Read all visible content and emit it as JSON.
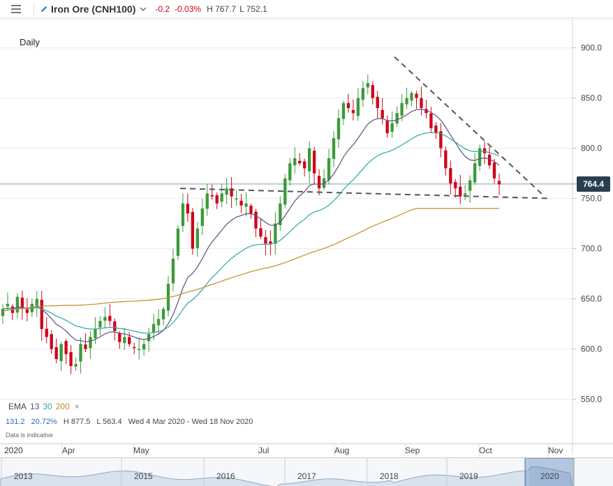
{
  "header": {
    "menu_icon": "hamburger-menu-icon",
    "edit_icon": "pencil-icon",
    "instrument_title": "Iron Ore (CNH100)",
    "chevron_icon": "chevron-down-icon",
    "change": "-0.2",
    "change_pct": "-0.03%",
    "high": "H 767.7",
    "low": "L 752.1"
  },
  "period_label": "Daily",
  "last_price": "764.4",
  "ema_legend": {
    "label": "EMA",
    "period_1": "13",
    "period_2": "30",
    "period_3": "200",
    "remove": "×"
  },
  "stats": {
    "change_abs": "131.2",
    "change_pct": "20.72%",
    "high": "H 877.5",
    "low": "L 563.4",
    "range": "Wed 4 Mar 2020 - Wed 18 Nov 2020"
  },
  "disclaimer": "Data is indicative",
  "colors": {
    "up": "#3a9b3a",
    "down": "#d0021b",
    "ema13": "#5b4f7a",
    "ema30": "#2aa7a3",
    "ema200": "#c68b2a",
    "trendline": "#555555",
    "price_label_bg": "#2b3e50"
  },
  "timeline": {
    "year_label": "2020",
    "months": [
      "Apr",
      "May",
      "Jul",
      "Aug",
      "Sep",
      "Oct",
      "Nov"
    ]
  },
  "navigator": {
    "years": [
      "2013",
      "2015",
      "2016",
      "2017",
      "2018",
      "2019",
      "2020"
    ]
  },
  "chart_data": {
    "type": "candlestick",
    "title": "Iron Ore (CNH100)",
    "interval": "Daily",
    "y_axis_ticks": [
      550,
      600,
      650,
      700,
      750,
      800,
      850,
      900
    ],
    "ylim": [
      540,
      915
    ],
    "x_axis_ticks": [
      "Apr",
      "May",
      "Jul",
      "Aug",
      "Sep",
      "Oct",
      "Nov"
    ],
    "grid": true,
    "last_price": 764.4,
    "range_high": 877.5,
    "range_low": 563.4,
    "closes": [
      640,
      645,
      636,
      652,
      640,
      636,
      645,
      650,
      620,
      612,
      600,
      590,
      605,
      595,
      583,
      585,
      605,
      600,
      612,
      620,
      628,
      632,
      628,
      618,
      607,
      612,
      605,
      602,
      600,
      605,
      615,
      625,
      630,
      640,
      665,
      690,
      720,
      745,
      735,
      700,
      720,
      740,
      755,
      752,
      745,
      755,
      760,
      752,
      750,
      743,
      745,
      735,
      720,
      712,
      705,
      705,
      725,
      745,
      770,
      785,
      790,
      785,
      780,
      800,
      775,
      760,
      770,
      790,
      810,
      830,
      845,
      840,
      835,
      850,
      860,
      865,
      850,
      840,
      830,
      815,
      825,
      835,
      845,
      850,
      855,
      850,
      840,
      835,
      820,
      815,
      800,
      780,
      765,
      760,
      752,
      755,
      768,
      785,
      800,
      795,
      783,
      770,
      764
    ],
    "series": [
      {
        "name": "EMA 13",
        "color": "#5b4f7a"
      },
      {
        "name": "EMA 30",
        "color": "#2aa7a3"
      },
      {
        "name": "EMA 200",
        "color": "#c68b2a"
      }
    ]
  }
}
